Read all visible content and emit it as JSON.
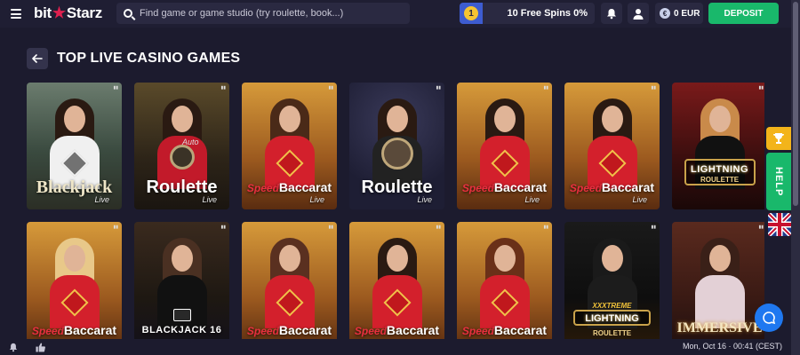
{
  "header": {
    "logo_left": "bit",
    "logo_right": "Starz",
    "search_placeholder": "Find game or game studio (try roulette, book...)",
    "level_badge": "1",
    "free_spins": "10 Free Spins 0%",
    "balance": "0 EUR",
    "currency_symbol": "€",
    "deposit_label": "DEPOSIT"
  },
  "page": {
    "title": "TOP LIVE CASINO GAMES"
  },
  "games_row1": [
    {
      "name": "Blackjack",
      "sub": "Live",
      "style": "blackjack"
    },
    {
      "name": "Roulette",
      "sub": "Live",
      "style": "roulette",
      "tag": "Auto"
    },
    {
      "prefix": "Speed",
      "name": "Baccarat",
      "sub": "Live",
      "style": "baccarat"
    },
    {
      "name": "Roulette",
      "sub": "Live",
      "style": "roulette2"
    },
    {
      "prefix": "Speed",
      "name": "Baccarat",
      "sub": "Live",
      "style": "baccarat"
    },
    {
      "prefix": "Speed",
      "name": "Baccarat",
      "sub": "Live",
      "style": "baccarat"
    },
    {
      "name": "LIGHTNING",
      "sub": "ROULETTE",
      "style": "lightning"
    }
  ],
  "games_row2": [
    {
      "prefix": "Speed",
      "name": "Baccarat",
      "style": "baccarat"
    },
    {
      "name": "BLACKJACK 16",
      "style": "bj16"
    },
    {
      "prefix": "Speed",
      "name": "Baccarat",
      "style": "baccarat"
    },
    {
      "prefix": "Speed",
      "name": "Baccarat",
      "style": "baccarat"
    },
    {
      "prefix": "Speed",
      "name": "Baccarat",
      "style": "baccarat"
    },
    {
      "name": "LIGHTNING",
      "prefix": "XXXTREME",
      "sub": "ROULETTE",
      "style": "xxx"
    },
    {
      "name": "IMMERSIVE",
      "style": "immersive"
    }
  ],
  "side": {
    "help_label": "HELP"
  },
  "footer": {
    "datetime": "Mon, Oct 16 · 00:41 (CEST)"
  },
  "colors": {
    "background": "#1c1b2e",
    "deposit": "#19b86b",
    "accent_red": "#e0204f",
    "trophy": "#f3b41a"
  }
}
